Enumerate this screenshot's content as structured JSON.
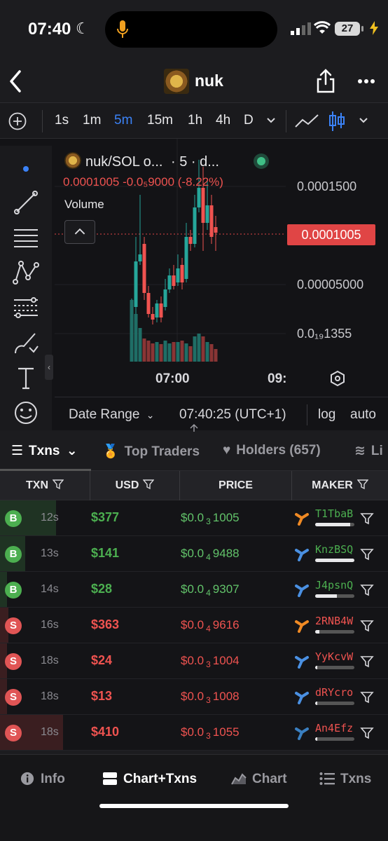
{
  "status": {
    "time": "07:40",
    "battery": "27"
  },
  "header": {
    "title": "nuk"
  },
  "toolbar": {
    "timeframes": [
      "1s",
      "1m",
      "5m",
      "15m",
      "1h",
      "4h",
      "D"
    ],
    "active": "5m"
  },
  "chart": {
    "pair": "nuk/SOL o...",
    "pair_meta": "· 5 · d...",
    "ohlc": "0.0001005  -0.0₅9000 (-8.22%)",
    "volume_label": "Volume",
    "price_tag": "0.0001005",
    "axis": [
      "0.0001500",
      "0.00005000",
      "0.0₁₉1355"
    ],
    "time_labels": [
      "07:00",
      "09:"
    ],
    "range_label": "Date Range",
    "clock": "07:40:25 (UTC+1)",
    "log": "log",
    "auto": "auto"
  },
  "tabs": [
    "Txns",
    "Top Traders",
    "Holders (657)",
    "Li"
  ],
  "table": {
    "headers": [
      "TXN",
      "USD",
      "PRICE",
      "MAKER"
    ],
    "rows": [
      {
        "side": "B",
        "age": "12s",
        "usd": "$377",
        "price_a": "$0.0",
        "price_sub": "3",
        "price_b": "1005",
        "maker": "T1TbaB",
        "fill": 0.9
      },
      {
        "side": "B",
        "age": "13s",
        "usd": "$141",
        "price_a": "$0.0",
        "price_sub": "4",
        "price_b": "9488",
        "maker": "KnzBSQ",
        "fill": 1.0
      },
      {
        "side": "B",
        "age": "14s",
        "usd": "$28",
        "price_a": "$0.0",
        "price_sub": "4",
        "price_b": "9307",
        "maker": "J4psnQ",
        "fill": 0.55
      },
      {
        "side": "S",
        "age": "16s",
        "usd": "$363",
        "price_a": "$0.0",
        "price_sub": "4",
        "price_b": "9616",
        "maker": "2RNB4W",
        "fill": 0.1
      },
      {
        "side": "S",
        "age": "18s",
        "usd": "$24",
        "price_a": "$0.0",
        "price_sub": "3",
        "price_b": "1004",
        "maker": "YyKcvW",
        "fill": 0.05
      },
      {
        "side": "S",
        "age": "18s",
        "usd": "$13",
        "price_a": "$0.0",
        "price_sub": "3",
        "price_b": "1008",
        "maker": "dRYcro",
        "fill": 0.05
      },
      {
        "side": "S",
        "age": "18s",
        "usd": "$410",
        "price_a": "$0.0",
        "price_sub": "3",
        "price_b": "1055",
        "maker": "An4Efz",
        "fill": 0.05
      }
    ]
  },
  "bottomnav": [
    "Info",
    "Chart+Txns",
    "Chart",
    "Txns"
  ],
  "colors": {
    "buy": "#4caf50",
    "sell": "#ef5350",
    "accent": "#3b82f6"
  }
}
